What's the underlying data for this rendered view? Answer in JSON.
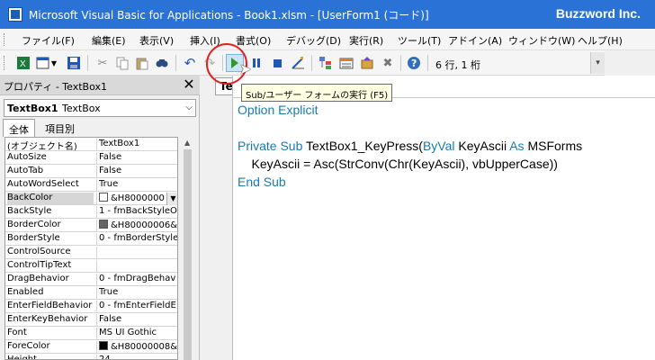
{
  "window": {
    "title": "Microsoft Visual Basic for Applications - Book1.xlsm - [UserForm1 (コード)]",
    "brand": "Buzzword Inc."
  },
  "menu": [
    "ファイル(F)",
    "編集(E)",
    "表示(V)",
    "挿入(I)",
    "書式(O)",
    "デバッグ(D)",
    "実行(R)",
    "ツール(T)",
    "アドイン(A)",
    "ウィンドウ(W)",
    "ヘルプ(H)"
  ],
  "toolbar": {
    "icons": [
      "excel-icon",
      "insert-form-icon",
      "save-icon",
      "cut-icon",
      "copy-icon",
      "paste-icon",
      "find-icon",
      "undo-icon",
      "redo-icon",
      "run-icon",
      "break-icon",
      "reset-icon",
      "design-mode-icon",
      "project-explorer-icon",
      "properties-window-icon",
      "object-browser-icon",
      "toolbox-icon",
      "help-icon"
    ],
    "position": "6 行, 1 桁",
    "run_tooltip": "Sub/ユーザー フォームの実行 (F5)"
  },
  "properties": {
    "title": "プロパティ - TextBox1",
    "close": "✕",
    "object_name": "TextBox1",
    "object_type": "TextBox",
    "tabs": [
      "全体",
      "項目別"
    ],
    "rows": [
      {
        "name": "(オブジェクト名)",
        "value": "TextBox1"
      },
      {
        "name": "AutoSize",
        "value": "False"
      },
      {
        "name": "AutoTab",
        "value": "False"
      },
      {
        "name": "AutoWordSelect",
        "value": "True"
      },
      {
        "name": "BackColor",
        "value": "&H8000000",
        "swatch": "#ffffff",
        "dropdown": true
      },
      {
        "name": "BackStyle",
        "value": "1 - fmBackStyleO"
      },
      {
        "name": "BorderColor",
        "value": "&H80000006&",
        "swatch": "#646464"
      },
      {
        "name": "BorderStyle",
        "value": "0 - fmBorderStyle"
      },
      {
        "name": "ControlSource",
        "value": ""
      },
      {
        "name": "ControlTipText",
        "value": ""
      },
      {
        "name": "DragBehavior",
        "value": "0 - fmDragBehav"
      },
      {
        "name": "Enabled",
        "value": "True"
      },
      {
        "name": "EnterFieldBehavior",
        "value": "0 - fmEnterFieldE"
      },
      {
        "name": "EnterKeyBehavior",
        "value": "False"
      },
      {
        "name": "Font",
        "value": "MS UI Gothic"
      },
      {
        "name": "ForeColor",
        "value": "&H80000008&",
        "swatch": "#000000"
      },
      {
        "name": "Height",
        "value": "24"
      }
    ]
  },
  "code": {
    "object_box": "TextBox1",
    "lines": [
      [
        {
          "t": "Option Explicit",
          "k": true
        }
      ],
      [
        {
          "t": ""
        }
      ],
      [
        {
          "t": "Private Sub",
          "k": true
        },
        {
          "t": " TextBox1_KeyPress("
        },
        {
          "t": "ByVal",
          "k": true
        },
        {
          "t": " KeyAscii "
        },
        {
          "t": "As",
          "k": true
        },
        {
          "t": " MSForms"
        }
      ],
      [
        {
          "t": "    KeyAscii = Asc(StrConv(Chr(KeyAscii), vbUpperCase))"
        }
      ],
      [
        {
          "t": "End Sub",
          "k": true
        }
      ]
    ]
  }
}
